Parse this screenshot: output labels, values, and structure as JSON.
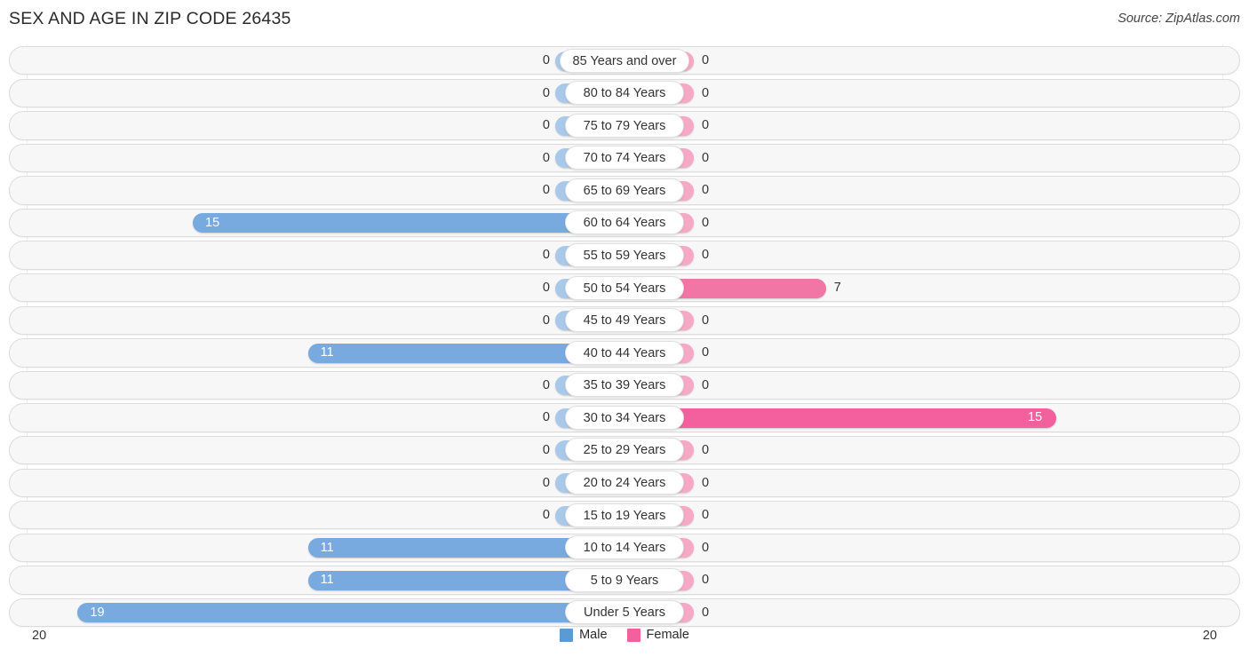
{
  "header": {
    "title": "SEX AND AGE IN ZIP CODE 26435",
    "source": "Source: ZipAtlas.com"
  },
  "legend": {
    "male_label": "Male",
    "female_label": "Female",
    "male_color": "#5b9bd5",
    "female_color": "#f4609e"
  },
  "axis": {
    "left_max": "20",
    "right_max": "20"
  },
  "chart_data": {
    "type": "bar",
    "title": "SEX AND AGE IN ZIP CODE 26435",
    "subtitle": "Source: ZipAtlas.com",
    "orientation": "horizontal-diverging",
    "xlabel": "",
    "ylabel": "",
    "xlim": [
      20,
      20
    ],
    "grid": true,
    "legend_position": "bottom-center",
    "categories": [
      "85 Years and over",
      "80 to 84 Years",
      "75 to 79 Years",
      "70 to 74 Years",
      "65 to 69 Years",
      "60 to 64 Years",
      "55 to 59 Years",
      "50 to 54 Years",
      "45 to 49 Years",
      "40 to 44 Years",
      "35 to 39 Years",
      "30 to 34 Years",
      "25 to 29 Years",
      "20 to 24 Years",
      "15 to 19 Years",
      "10 to 14 Years",
      "5 to 9 Years",
      "Under 5 Years"
    ],
    "series": [
      {
        "name": "Male",
        "color": "#5b9bd5",
        "values": [
          0,
          0,
          0,
          0,
          0,
          15,
          0,
          0,
          0,
          11,
          0,
          0,
          0,
          0,
          0,
          11,
          11,
          19
        ]
      },
      {
        "name": "Female",
        "color": "#f4609e",
        "values": [
          0,
          0,
          0,
          0,
          0,
          0,
          0,
          7,
          0,
          0,
          0,
          15,
          0,
          0,
          0,
          0,
          0,
          0
        ]
      }
    ]
  },
  "rows": [
    {
      "label": "85 Years and over",
      "male": "0",
      "female": "0"
    },
    {
      "label": "80 to 84 Years",
      "male": "0",
      "female": "0"
    },
    {
      "label": "75 to 79 Years",
      "male": "0",
      "female": "0"
    },
    {
      "label": "70 to 74 Years",
      "male": "0",
      "female": "0"
    },
    {
      "label": "65 to 69 Years",
      "male": "0",
      "female": "0"
    },
    {
      "label": "60 to 64 Years",
      "male": "15",
      "female": "0"
    },
    {
      "label": "55 to 59 Years",
      "male": "0",
      "female": "0"
    },
    {
      "label": "50 to 54 Years",
      "male": "0",
      "female": "7"
    },
    {
      "label": "45 to 49 Years",
      "male": "0",
      "female": "0"
    },
    {
      "label": "40 to 44 Years",
      "male": "11",
      "female": "0"
    },
    {
      "label": "35 to 39 Years",
      "male": "0",
      "female": "0"
    },
    {
      "label": "30 to 34 Years",
      "male": "0",
      "female": "15"
    },
    {
      "label": "25 to 29 Years",
      "male": "0",
      "female": "0"
    },
    {
      "label": "20 to 24 Years",
      "male": "0",
      "female": "0"
    },
    {
      "label": "15 to 19 Years",
      "male": "0",
      "female": "0"
    },
    {
      "label": "10 to 14 Years",
      "male": "11",
      "female": "0"
    },
    {
      "label": "5 to 9 Years",
      "male": "11",
      "female": "0"
    },
    {
      "label": "Under 5 Years",
      "male": "19",
      "female": "0"
    }
  ]
}
